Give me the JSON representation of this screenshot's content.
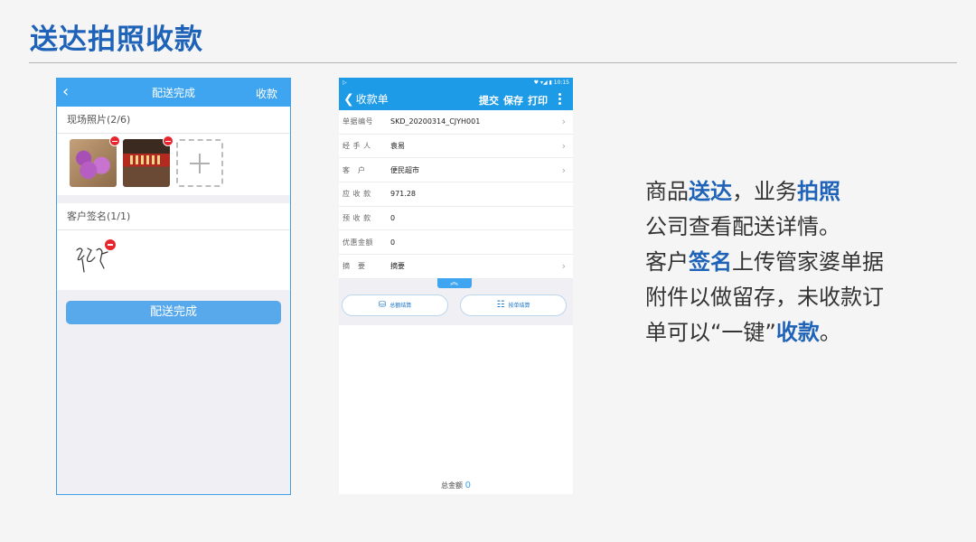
{
  "slide": {
    "title": "送达拍照收款"
  },
  "phone1": {
    "nav": {
      "back_icon": "chevron-left-icon",
      "title": "配送完成",
      "action": "收款"
    },
    "photos": {
      "header": "现场照片(2/6)"
    },
    "signature": {
      "header": "客户签名(1/1)"
    },
    "done_button": "配送完成"
  },
  "phone2": {
    "nav": {
      "back_label": "收款单",
      "actions": [
        "提交",
        "保存",
        "打印"
      ]
    },
    "status_time": "10:15",
    "fields": [
      {
        "label": "单据编号",
        "value": "SKD_20200314_CJYH001",
        "chevron": true
      },
      {
        "label": "经 手 人",
        "value": "袁易",
        "chevron": true
      },
      {
        "label": "客　户",
        "value": "便民超市",
        "chevron": true
      },
      {
        "label": "应 收 款",
        "value": "971.28",
        "chevron": false
      },
      {
        "label": "预 收 款",
        "value": "0",
        "chevron": false
      },
      {
        "label": "优惠金额",
        "value": "0",
        "chevron": false
      },
      {
        "label": "摘　要",
        "value": "摘要",
        "chevron": true
      }
    ],
    "buttons": {
      "total_settle": "总额结算",
      "per_bill_settle": "按单结算"
    },
    "total": {
      "label": "总金额",
      "value": "0"
    }
  },
  "description": {
    "lines": [
      [
        {
          "t": "商品"
        },
        {
          "t": "送达",
          "b": true
        },
        {
          "t": "，业务"
        },
        {
          "t": "拍照",
          "b": true
        }
      ],
      [
        {
          "t": "公司查看配送详情。"
        }
      ],
      [
        {
          "t": "客户"
        },
        {
          "t": "签名",
          "b": true
        },
        {
          "t": "上传管家婆单据"
        }
      ],
      [
        {
          "t": "附件以做留存，未收款订"
        }
      ],
      [
        {
          "t": "单可以“一键”"
        },
        {
          "t": "收款",
          "b": true
        },
        {
          "t": "。"
        }
      ]
    ]
  },
  "colors": {
    "accent": "#1f63b8",
    "app_bar": "#3fa5f0",
    "danger": "#e8242c"
  }
}
